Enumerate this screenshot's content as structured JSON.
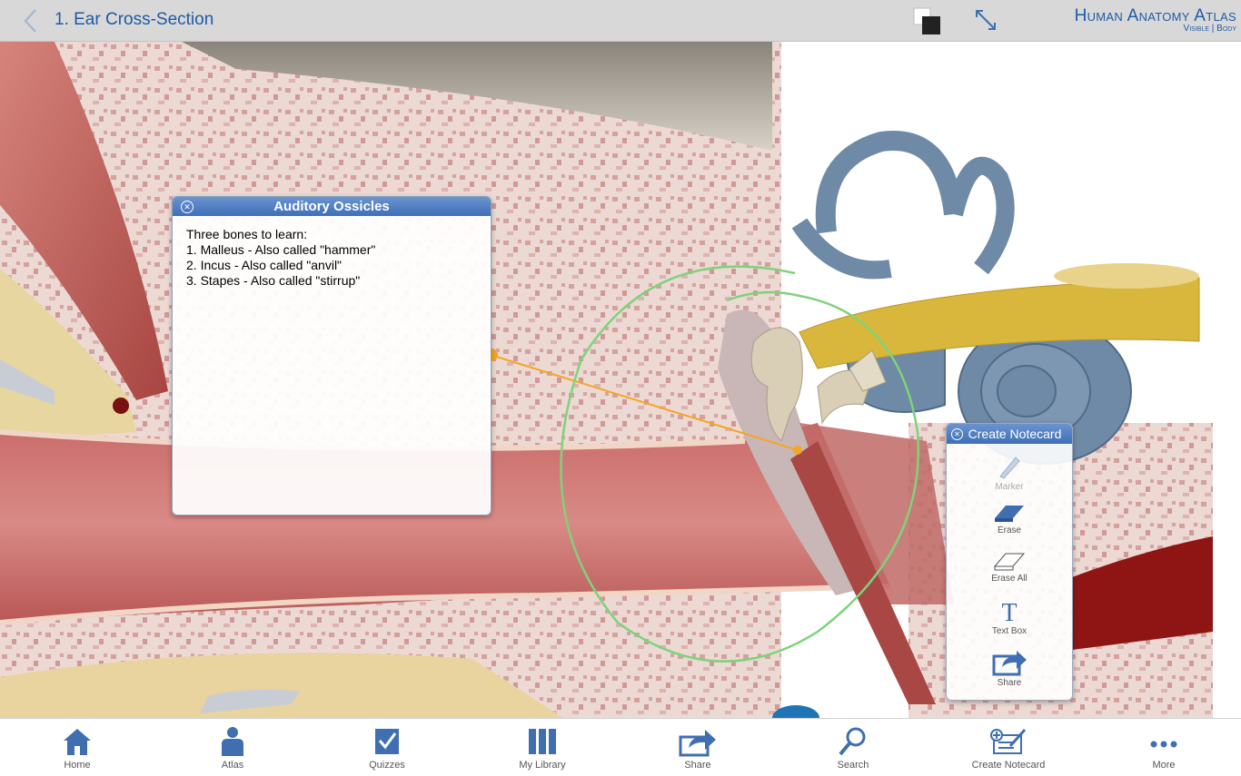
{
  "header": {
    "title": "1. Ear Cross-Section",
    "brand_title": "Human Anatomy Atlas",
    "brand_sub": "Visible | Body"
  },
  "popup": {
    "title": "Auditory Ossicles",
    "lines": [
      "Three bones to learn:",
      "1. Malleus - Also called \"hammer\"",
      "2. Incus - Also called \"anvil\"",
      "3. Stapes - Also called \"stirrup\""
    ]
  },
  "notecard": {
    "title": "Create Notecard",
    "tools": [
      {
        "label": "Marker",
        "icon": "marker-icon"
      },
      {
        "label": "Erase",
        "icon": "eraser-icon"
      },
      {
        "label": "Erase All",
        "icon": "eraser-outline-icon"
      },
      {
        "label": "Text Box",
        "icon": "text-icon"
      },
      {
        "label": "Share",
        "icon": "share-icon"
      }
    ]
  },
  "tabs": [
    {
      "label": "Home",
      "icon": "home-icon"
    },
    {
      "label": "Atlas",
      "icon": "person-icon"
    },
    {
      "label": "Quizzes",
      "icon": "checkbox-icon"
    },
    {
      "label": "My Library",
      "icon": "library-icon"
    },
    {
      "label": "Share",
      "icon": "share-icon"
    },
    {
      "label": "Search",
      "icon": "search-icon"
    },
    {
      "label": "Create Notecard",
      "icon": "notecard-icon"
    },
    {
      "label": "More",
      "icon": "more-icon"
    }
  ],
  "colors": {
    "accent": "#1f5aa6",
    "header_bg": "#d8d8d8",
    "annotation_green": "#7ed37a",
    "pin_orange": "#f5a623"
  }
}
